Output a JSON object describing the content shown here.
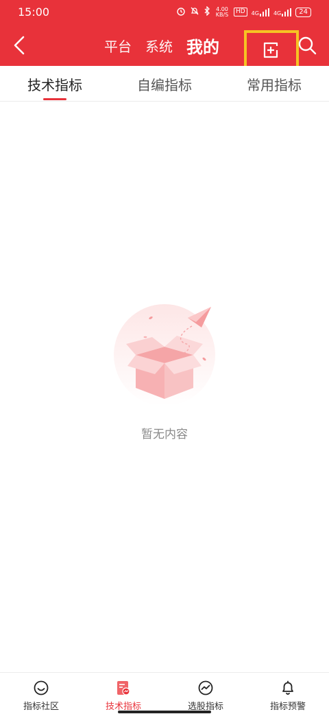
{
  "status_bar": {
    "time": "15:00",
    "net_speed": "4.00 KB/S",
    "hd_label": "HD",
    "signal_1": "4G",
    "signal_2": "4G",
    "battery": "24"
  },
  "nav": {
    "tabs": [
      {
        "label": "平台"
      },
      {
        "label": "系统"
      },
      {
        "label": "我的"
      }
    ],
    "active_tab": "我的",
    "highlight_color": "#f6c323",
    "brand_color": "#e8323a"
  },
  "subtabs": [
    {
      "label": "技术指标"
    },
    {
      "label": "自编指标"
    },
    {
      "label": "常用指标"
    }
  ],
  "empty_state": {
    "message": "暂无内容"
  },
  "bottom_nav": [
    {
      "label": "指标社区",
      "icon": "smile-icon"
    },
    {
      "label": "技术指标",
      "icon": "indicator-doc-icon"
    },
    {
      "label": "选股指标",
      "icon": "trend-chart-icon"
    },
    {
      "label": "指标预警",
      "icon": "bell-icon"
    }
  ]
}
